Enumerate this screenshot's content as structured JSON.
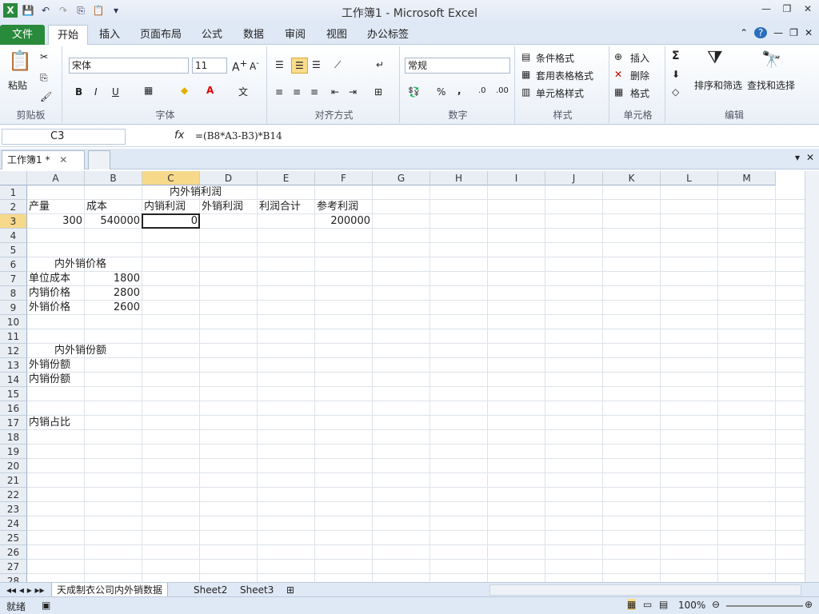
{
  "app": {
    "title": "工作簿1 - Microsoft Excel"
  },
  "menu": {
    "tabs": [
      "文件",
      "开始",
      "插入",
      "页面布局",
      "公式",
      "数据",
      "审阅",
      "视图",
      "办公标签"
    ]
  },
  "ribbon": {
    "clipboard": {
      "label": "剪贴板",
      "paste": "粘贴"
    },
    "font": {
      "label": "字体",
      "name": "宋体",
      "size": "11",
      "bold": "B",
      "italic": "I",
      "underline": "U"
    },
    "align": {
      "label": "对齐方式"
    },
    "number": {
      "label": "数字",
      "format": "常规",
      "percent": "%",
      "comma": ","
    },
    "styles": {
      "label": "样式",
      "cond": "条件格式",
      "table": "套用表格格式",
      "cell": "单元格样式"
    },
    "cells": {
      "label": "单元格",
      "insert": "插入",
      "delete": "删除",
      "format": "格式"
    },
    "edit": {
      "label": "编辑",
      "sort": "排序和筛选",
      "find": "查找和选择",
      "sigma": "Σ"
    }
  },
  "formula_bar": {
    "name": "C3",
    "fx": "fx",
    "formula": "=(B8*A3-B3)*B14"
  },
  "workbook_tab": "工作簿1 *",
  "columns": [
    "A",
    "B",
    "C",
    "D",
    "E",
    "F",
    "G",
    "H",
    "I",
    "J",
    "K",
    "L",
    "M"
  ],
  "rows": [
    "1",
    "2",
    "3",
    "4",
    "5",
    "6",
    "7",
    "8",
    "9",
    "10",
    "11",
    "12",
    "13",
    "14",
    "15",
    "16",
    "17",
    "18",
    "19",
    "20",
    "21",
    "22",
    "23",
    "24",
    "25",
    "26",
    "27",
    "28"
  ],
  "cells": {
    "c1": "内外销利润",
    "a2": "产量",
    "b2": "成本",
    "c2": "内销利润",
    "d2": "外销利润",
    "e2": "利润合计",
    "f2": "参考利润",
    "a3": "300",
    "b3": "540000",
    "c3": "0",
    "f3": "200000",
    "a6": "内外销价格",
    "a7": "单位成本",
    "b7": "1800",
    "a8": "内销价格",
    "b8": "2800",
    "a9": "外销价格",
    "b9": "2600",
    "a12": "内外销份额",
    "a13": "外销份额",
    "a14": "内销份额",
    "a17": "内销占比"
  },
  "sheets": [
    "天成制衣公司内外销数据",
    "Sheet2",
    "Sheet3"
  ],
  "status": {
    "ready": "就绪",
    "zoom": "100%"
  }
}
